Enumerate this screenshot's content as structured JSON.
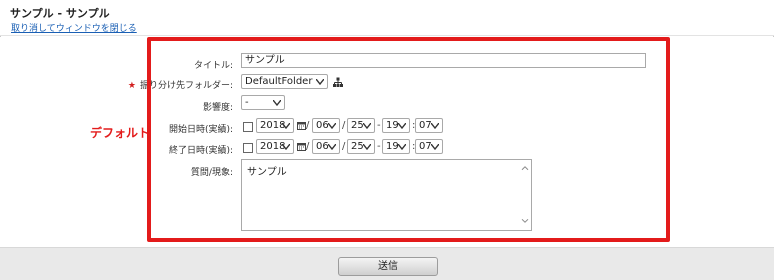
{
  "window": {
    "title": "サンプル - サンプル",
    "close_link": "取り消してウィンドウを閉じる"
  },
  "annotation": {
    "label": "デフォルト",
    "color": "#e31b1b"
  },
  "form": {
    "title_label": "タイトル:",
    "title_value": "サンプル",
    "required_mark": "★",
    "folder_label": "振り分け先フォルダー:",
    "folder_value": "DefaultFolder",
    "impact_label": "影響度:",
    "impact_value": "-",
    "start": {
      "label": "開始日時(実績):",
      "year": "2018",
      "month": "06",
      "day": "25",
      "hour": "19",
      "minute": "07",
      "date_sep": "/",
      "time_sep": "-",
      "colon": ":"
    },
    "end": {
      "label": "終了日時(実績):",
      "year": "2018",
      "month": "06",
      "day": "25",
      "hour": "19",
      "minute": "07",
      "date_sep": "/",
      "time_sep": "-",
      "colon": ":"
    },
    "question_label": "質問/現象:",
    "question_value": "サンプル"
  },
  "footer": {
    "submit_label": "送信"
  },
  "icons": {
    "folder_tree": "folder-tree-icon",
    "calendar": "calendar-icon",
    "chevron": "chevron-down-icon"
  }
}
